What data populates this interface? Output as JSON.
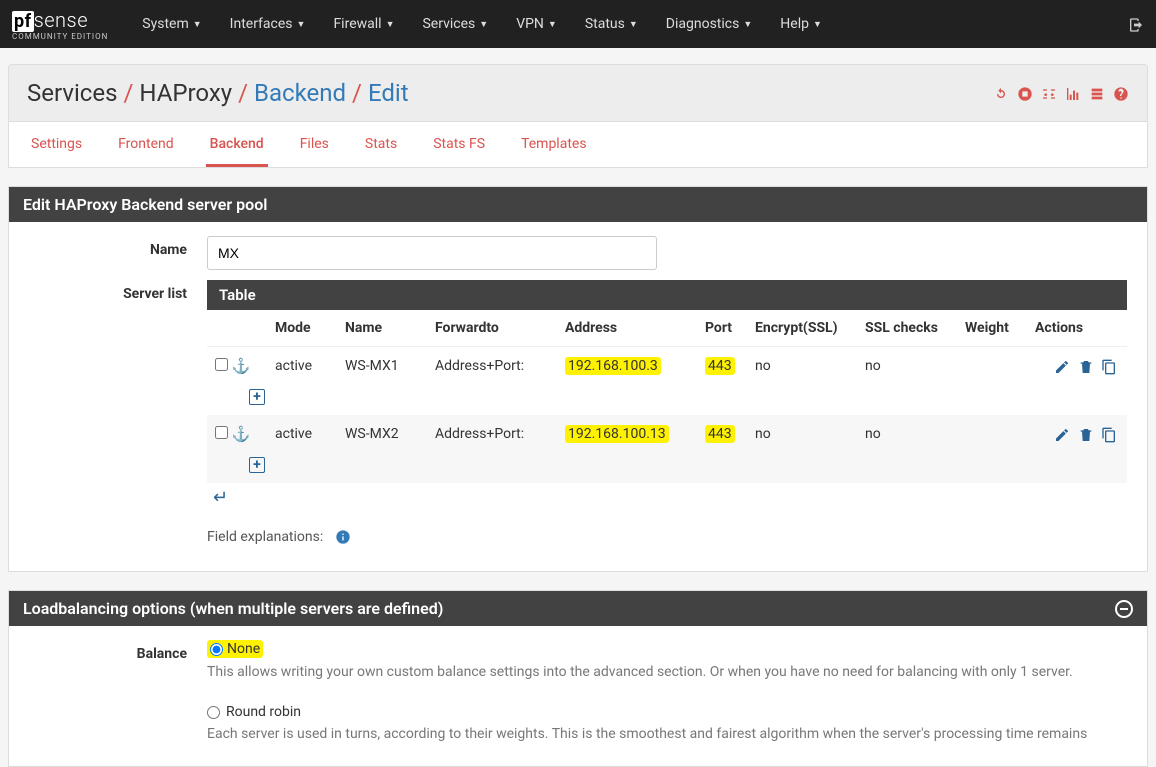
{
  "logo": {
    "main1": "pf",
    "main2": "sense",
    "sub": "COMMUNITY EDITION"
  },
  "topnav": [
    "System",
    "Interfaces",
    "Firewall",
    "Services",
    "VPN",
    "Status",
    "Diagnostics",
    "Help"
  ],
  "breadcrumb": {
    "a": "Services",
    "b": "HAProxy",
    "c": "Backend",
    "d": "Edit"
  },
  "tabs": [
    "Settings",
    "Frontend",
    "Backend",
    "Files",
    "Stats",
    "Stats FS",
    "Templates"
  ],
  "active_tab": 2,
  "panel1": {
    "title": "Edit HAProxy Backend server pool",
    "name_label": "Name",
    "name_value": "MX",
    "serverlist_label": "Server list",
    "table_title": "Table",
    "cols": [
      "",
      "Mode",
      "Name",
      "Forwardto",
      "Address",
      "Port",
      "Encrypt(SSL)",
      "SSL checks",
      "Weight",
      "Actions"
    ],
    "rows": [
      {
        "mode": "active",
        "name": "WS-MX1",
        "fwd": "Address+Port:",
        "addr": "192.168.100.3",
        "port": "443",
        "enc": "no",
        "sslc": "no",
        "weight": ""
      },
      {
        "mode": "active",
        "name": "WS-MX2",
        "fwd": "Address+Port:",
        "addr": "192.168.100.13",
        "port": "443",
        "enc": "no",
        "sslc": "no",
        "weight": ""
      }
    ],
    "field_expl": "Field explanations:"
  },
  "panel2": {
    "title": "Loadbalancing options (when multiple servers are defined)",
    "balance_label": "Balance",
    "opt_none": "None",
    "opt_none_help": "This allows writing your own custom balance settings into the advanced section. Or when you have no need for balancing with only 1 server.",
    "opt_rr": "Round robin",
    "opt_rr_help": "Each server is used in turns, according to their weights. This is the smoothest and fairest algorithm when the server's processing time remains"
  }
}
